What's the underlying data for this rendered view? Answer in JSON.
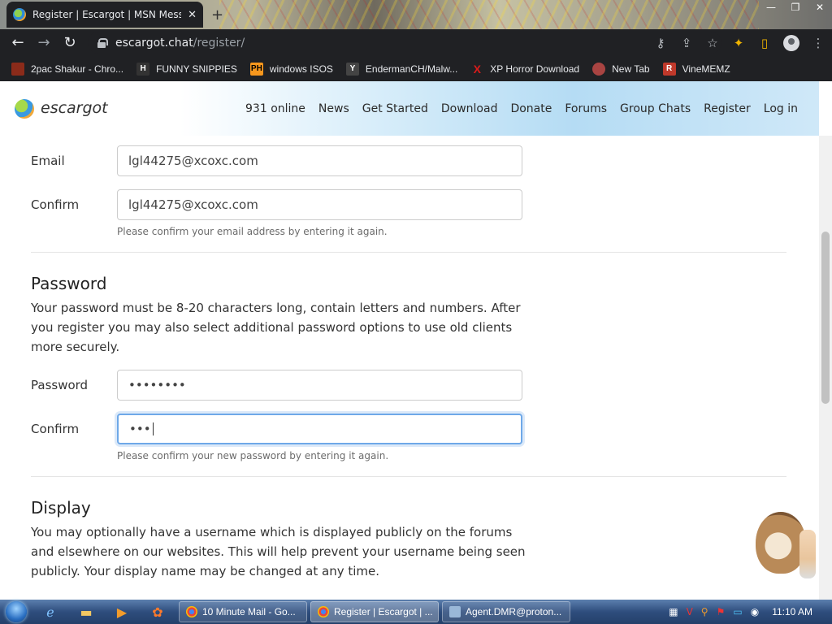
{
  "browser": {
    "tab_title": "Register | Escargot | MSN Messe",
    "tab_close": "✕",
    "new_tab": "+",
    "url_host": "escargot.chat",
    "url_path": "/register/",
    "bookmarks": [
      {
        "label": "2pac Shakur - Chro...",
        "icon": "bookmark-page-icon",
        "color": "#8b2b1a"
      },
      {
        "label": "FUNNY SNIPPIES",
        "icon": "H",
        "color": "#333333"
      },
      {
        "label": "windows ISOS",
        "icon": "PH",
        "color": "#f7971d"
      },
      {
        "label": "EndermanCH/Malw...",
        "icon": "Y",
        "color": "#444444"
      },
      {
        "label": "XP Horror Download",
        "icon": "X",
        "color": "#d81b1b"
      },
      {
        "label": "New Tab",
        "icon": "new-tab-icon",
        "color": "#a94442"
      },
      {
        "label": "VineMEMZ",
        "icon": "R",
        "color": "#c0392b"
      }
    ]
  },
  "site": {
    "logo": "escargot",
    "nav": [
      "931 online",
      "News",
      "Get Started",
      "Download",
      "Donate",
      "Forums",
      "Group Chats",
      "Register",
      "Log in"
    ]
  },
  "form": {
    "email_label": "Email",
    "email_value": "lgl44275@xcoxc.com",
    "confirm_email_label": "Confirm",
    "confirm_email_value": "lgl44275@xcoxc.com",
    "confirm_email_help": "Please confirm your email address by entering it again.",
    "password_heading": "Password",
    "password_desc": "Your password must be 8-20 characters long, contain letters and numbers. After you register you may also select additional password options to use old clients more securely.",
    "password_label": "Password",
    "password_value": "••••••••",
    "confirm_password_label": "Confirm",
    "confirm_password_value": "•••",
    "confirm_password_help": "Please confirm your new password by entering it again.",
    "display_heading": "Display",
    "display_desc": "You may optionally have a username which is displayed publicly on the forums and elsewhere on our websites. This will help prevent your username being seen publicly. Your display name may be changed at any time."
  },
  "taskbar": {
    "tasks": [
      {
        "label": "10 Minute Mail - Go...",
        "color": "#e8453c"
      },
      {
        "label": "Register | Escargot | ...",
        "color": "#e8453c"
      },
      {
        "label": "Agent.DMR@proton...",
        "color": "#9ab8d8"
      }
    ],
    "clock": "11:10 AM"
  },
  "colors": {
    "accent": "#6ea8e8",
    "chrome_dark": "#202124"
  }
}
